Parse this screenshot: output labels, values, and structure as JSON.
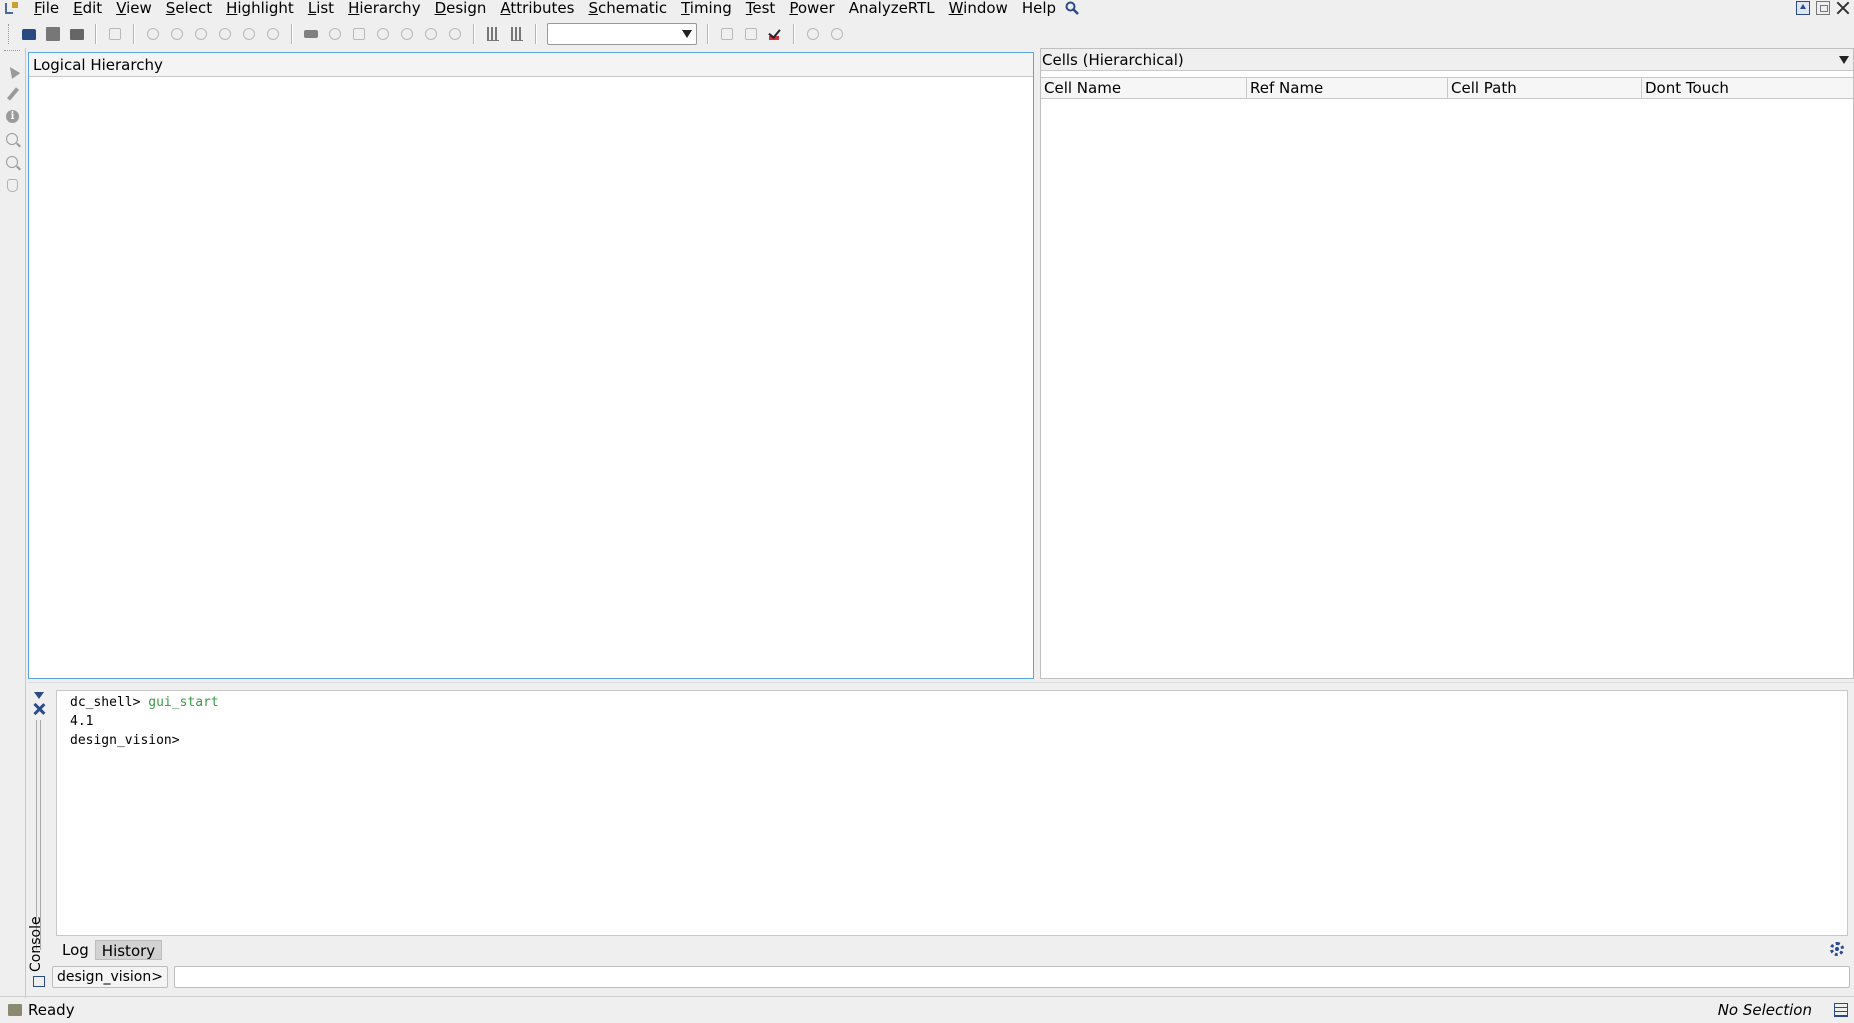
{
  "menubar": {
    "items": [
      {
        "mn": "F",
        "rest": "ile"
      },
      {
        "mn": "E",
        "rest": "dit"
      },
      {
        "mn": "V",
        "rest": "iew"
      },
      {
        "mn": "S",
        "rest": "elect"
      },
      {
        "mn": "H",
        "rest": "ighlight"
      },
      {
        "mn": "L",
        "rest": "ist"
      },
      {
        "mn": "H",
        "rest": "ierarchy"
      },
      {
        "mn": "D",
        "rest": "esign"
      },
      {
        "mn": "A",
        "rest": "ttributes"
      },
      {
        "mn": "S",
        "rest": "chematic"
      },
      {
        "mn": "T",
        "rest": "iming"
      },
      {
        "mn": "T",
        "rest": "est"
      },
      {
        "mn": "P",
        "rest": "ower"
      },
      {
        "mn": "",
        "rest": "AnalyzeRTL"
      },
      {
        "mn": "W",
        "rest": "indow"
      },
      {
        "mn": "",
        "rest": "Help"
      }
    ]
  },
  "toolbar": {
    "combo_value": ""
  },
  "hierarchy_panel": {
    "title": "Logical Hierarchy"
  },
  "cells_panel": {
    "title": "Cells (Hierarchical)",
    "columns": [
      "Cell Name",
      "Ref Name",
      "Cell Path",
      "Dont Touch"
    ]
  },
  "console": {
    "side_label": "Console",
    "lines": [
      {
        "prompt": "dc_shell>",
        "command": "gui_start"
      },
      {
        "prompt": "4.1",
        "command": ""
      },
      {
        "prompt": "design_vision>",
        "command": ""
      }
    ],
    "tabs": [
      "Log",
      "History"
    ],
    "prompt_label": "design_vision>",
    "input_value": ""
  },
  "status": {
    "left_text": "Ready",
    "right_text": "No Selection"
  }
}
